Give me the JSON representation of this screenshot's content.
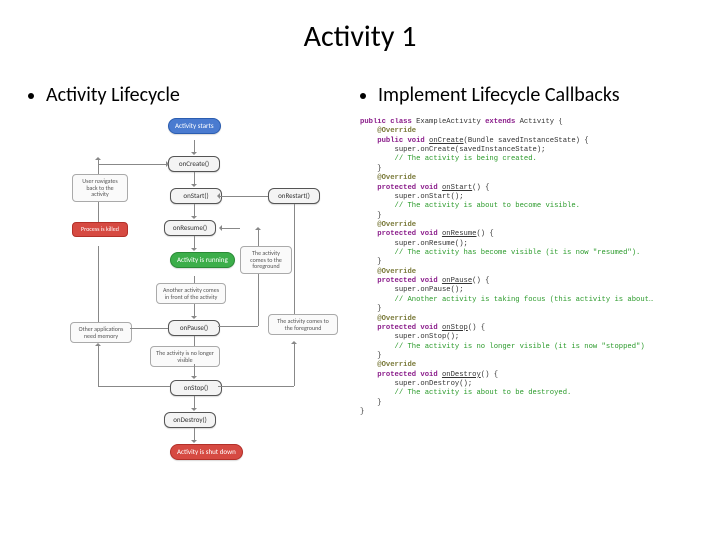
{
  "title": "Activity 1",
  "left_bullet": "Activity Lifecycle",
  "right_bullet": "Implement Lifecycle Callbacks",
  "flow": {
    "start": "Activity\nstarts",
    "onCreate": "onCreate()",
    "onStart": "onStart()",
    "onResume": "onResume()",
    "running": "Activity is\nrunning",
    "onPause": "onPause()",
    "onStop": "onStop()",
    "onDestroy": "onDestroy()",
    "shutdown": "Activity is\nshut down",
    "onRestart": "onRestart()",
    "noteNavBack": "User navigates\nback to the\nactivity",
    "noteKilled": "Process is\nkilled",
    "noteForeground": "The activity\ncomes to the\nforeground",
    "noteAnother": "Another activity comes\nin front of the activity",
    "noteOtherApps": "Other applications\nneed memory",
    "noteNoLonger": "The activity is no longer visible",
    "noteToForeground": "The activity\ncomes to the\nforeground"
  },
  "code": {
    "l01a": "public class ",
    "l01b": "ExampleActivity ",
    "l01c": "extends ",
    "l01d": "Activity {",
    "l02": "    @Override",
    "l03a": "    public void ",
    "l03b": "onCreate",
    "l03c": "(Bundle savedInstanceState) {",
    "l04": "        super.onCreate(savedInstanceState);",
    "l05": "        // The activity is being created.",
    "l06": "    }",
    "l07": "    @Override",
    "l08a": "    protected void ",
    "l08b": "onStart",
    "l08c": "() {",
    "l09": "        super.onStart();",
    "l10": "        // The activity is about to become visible.",
    "l11": "    }",
    "l12": "    @Override",
    "l13a": "    protected void ",
    "l13b": "onResume",
    "l13c": "() {",
    "l14": "        super.onResume();",
    "l15": "        // The activity has become visible (it is now \"resumed\").",
    "l16": "    }",
    "l17": "    @Override",
    "l18a": "    protected void ",
    "l18b": "onPause",
    "l18c": "() {",
    "l19": "        super.onPause();",
    "l20": "        // Another activity is taking focus (this activity is about…",
    "l21": "    }",
    "l22": "    @Override",
    "l23a": "    protected void ",
    "l23b": "onStop",
    "l23c": "() {",
    "l24": "        super.onStop();",
    "l25": "        // The activity is no longer visible (it is now \"stopped\")",
    "l26": "    }",
    "l27": "    @Override",
    "l28a": "    protected void ",
    "l28b": "onDestroy",
    "l28c": "() {",
    "l29": "        super.onDestroy();",
    "l30": "        // The activity is about to be destroyed.",
    "l31": "    }",
    "l32": "}"
  }
}
